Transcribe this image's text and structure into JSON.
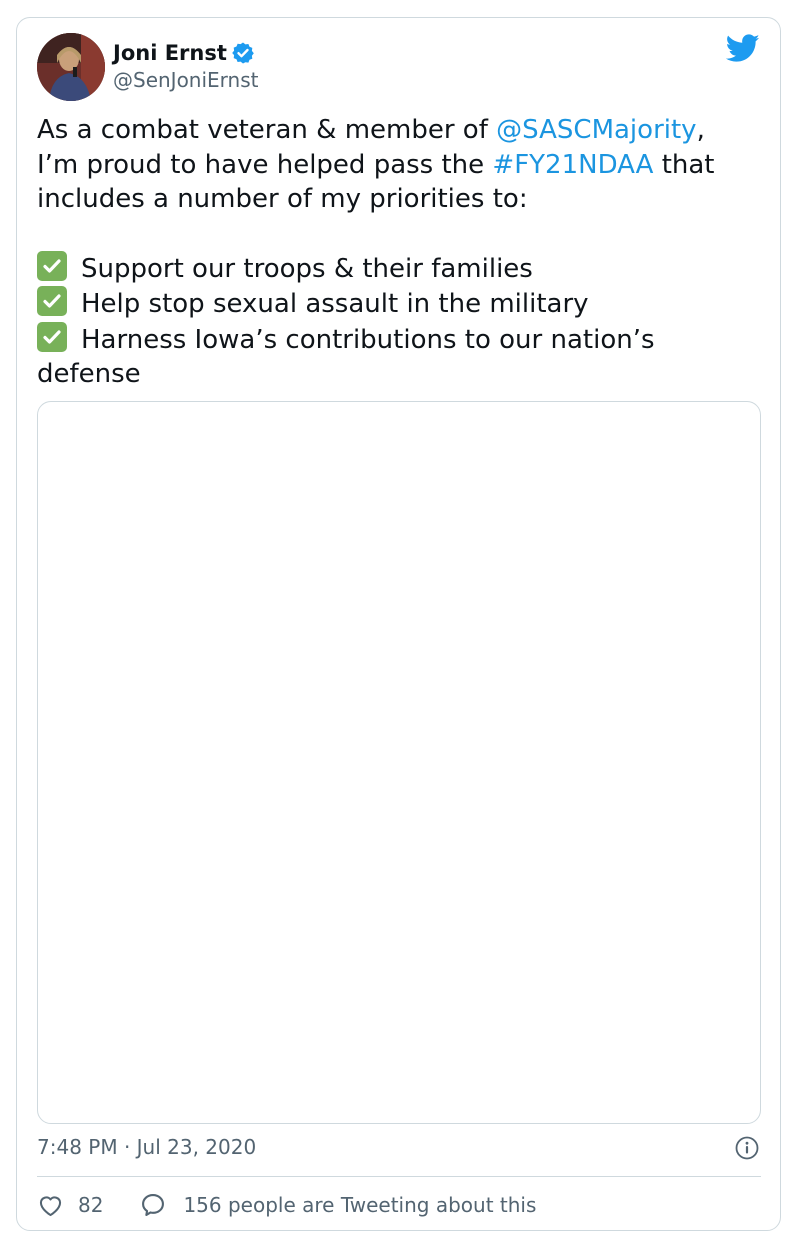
{
  "author": {
    "name": "Joni Ernst",
    "handle": "@SenJoniErnst"
  },
  "tweet": {
    "line1_pre": "As a combat veteran & member of ",
    "line1_mention": "@SASCMajority",
    "line1_post": ",",
    "line2_pre": "I’m proud to have helped pass the ",
    "line2_hashtag": "#FY21NDAA",
    "line2_post": " that",
    "line3": "includes a number of my priorities to:",
    "bullets": [
      "Support our troops & their families",
      "Help stop sexual assault in the military",
      "Harness Iowa’s contributions to our nation’s"
    ],
    "bullet_overflow": "defense"
  },
  "timestamp": "7:48 PM · Jul 23, 2020",
  "footer": {
    "likes": "82",
    "tweeting": "156 people are Tweeting about this"
  },
  "colors": {
    "link": "#1b95e0",
    "twitter_blue": "#1d9bf0",
    "check_green": "#78b159"
  },
  "icons": {
    "verified": "verified-badge-icon",
    "brand": "twitter-bird-icon",
    "check": "check-mark-button-icon",
    "info": "info-icon",
    "like": "heart-icon",
    "reply": "speech-bubble-icon"
  }
}
